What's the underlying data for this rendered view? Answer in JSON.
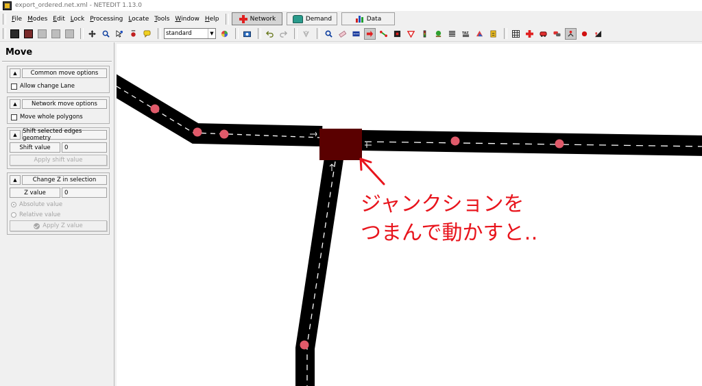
{
  "window": {
    "title": "export_ordered.net.xml - NETEDIT 1.13.0"
  },
  "menubar": {
    "items": [
      "File",
      "Modes",
      "Edit",
      "Lock",
      "Processing",
      "Locate",
      "Tools",
      "Window",
      "Help"
    ],
    "supermodes": [
      {
        "label": "Network",
        "icon": "network-cross-icon",
        "active": true
      },
      {
        "label": "Demand",
        "icon": "car-icon",
        "active": false
      },
      {
        "label": "Data",
        "icon": "bar-chart-icon",
        "active": false
      }
    ]
  },
  "toolbar": {
    "scheme_select": "standard",
    "scheme_arrow": "▼"
  },
  "sidebar": {
    "frame_title": "Move",
    "collapse_glyph": "▲",
    "common": {
      "title": "Common move options",
      "allow_change_lane": "Allow change Lane"
    },
    "network": {
      "title": "Network move options",
      "move_whole_polygons": "Move whole polygons"
    },
    "shift": {
      "title": "Shift selected edges geometry",
      "label": "Shift value",
      "value": "0",
      "button": "Apply shift value"
    },
    "changez": {
      "title": "Change Z in selection",
      "label": "Z value",
      "value": "0",
      "absolute": "Absolute value",
      "relative": "Relative value",
      "button": "Apply Z value"
    }
  },
  "annotation": {
    "line1": "ジャンクションを",
    "line2": "つまんで動かすと‥"
  },
  "colors": {
    "road": "#000000",
    "junction": "#5a0000",
    "geometry_point": "#e05a6a",
    "annotation": "#e8141c",
    "active_supermode": "#d4d4d4"
  }
}
